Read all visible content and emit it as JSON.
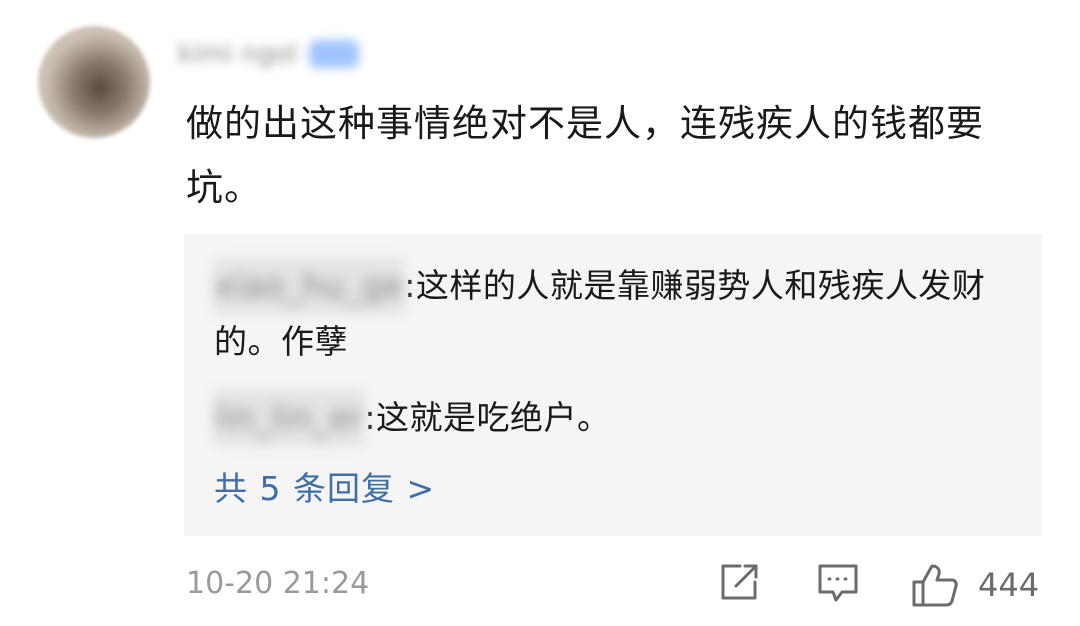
{
  "comment": {
    "username": "kimi ngol",
    "text": "做的出这种事情绝对不是人，连残疾人的钱都要坑。",
    "timestamp": "10-20 21:24"
  },
  "replies": [
    {
      "author": "xiao_hu_ge",
      "separator": ":",
      "text": "这样的人就是靠赚弱势人和残疾人发财的。作孽"
    },
    {
      "author": "lin_lin_er",
      "separator": ":",
      "text": "这就是吃绝户。"
    }
  ],
  "more_replies_label": "共 5 条回复 >",
  "actions": {
    "share_icon": "share-icon",
    "reply_icon": "comment-icon",
    "like_icon": "thumbs-up-icon",
    "like_count": "444"
  },
  "colors": {
    "link": "#3f6fa8",
    "reply_background": "#f5f5f5",
    "timestamp": "#9a9a9a"
  }
}
